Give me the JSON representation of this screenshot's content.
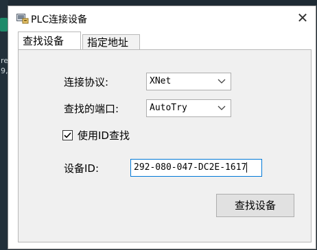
{
  "window": {
    "title": "PLC连接设备",
    "close_glyph": "✕"
  },
  "background": {
    "text_1": "re",
    "text_2": "9,"
  },
  "tabs": [
    {
      "label": "查找设备",
      "active": true
    },
    {
      "label": "指定地址",
      "active": false
    }
  ],
  "form": {
    "protocol_label": "连接协议:",
    "protocol_value": "XNet",
    "port_label": "查找的端口:",
    "port_value": "AutoTry",
    "use_id_label": "使用ID查找",
    "use_id_checked": true,
    "device_id_label": "设备ID:",
    "device_id_value": "292-080-047-DC2E-1617"
  },
  "actions": {
    "find_button": "查找设备"
  },
  "icons": {
    "app": "plc-device-icon",
    "close": "close-icon",
    "dropdown": "chevron-down-icon",
    "check": "checkmark-icon"
  }
}
